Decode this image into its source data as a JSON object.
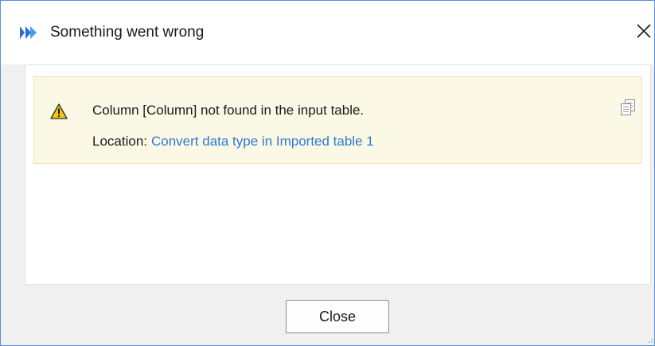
{
  "window": {
    "title": "Something went wrong",
    "app_icon": "app-logo-icon",
    "close_icon": "close-icon"
  },
  "error": {
    "icon": "warning-icon",
    "message": "Column [Column] not found in the input table.",
    "location_label": "Location:",
    "location_link": "Convert data type in Imported table 1",
    "copy_icon": "copy-icon"
  },
  "footer": {
    "close_label": "Close"
  },
  "colors": {
    "accent_link": "#2b7bd6",
    "warning_yellow": "#f2c811",
    "error_box_bg": "#fcf8e6",
    "window_border": "#5a8fd8"
  }
}
